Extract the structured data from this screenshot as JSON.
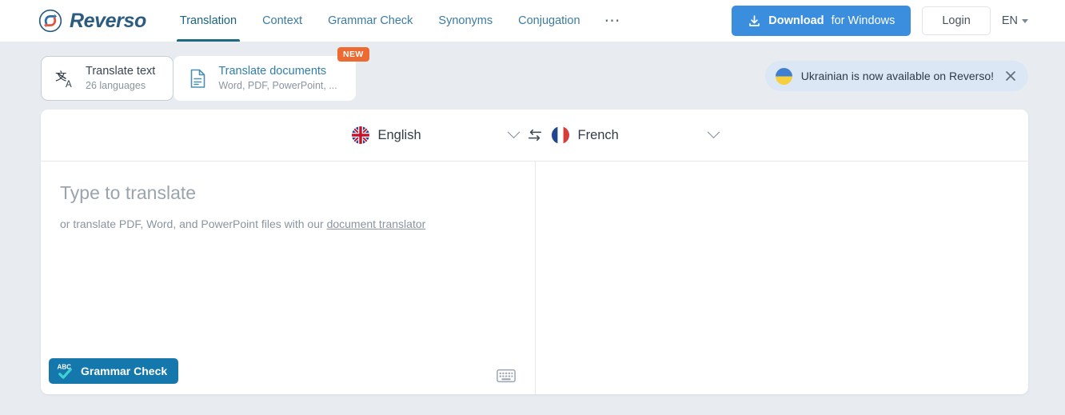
{
  "header": {
    "brand": "Reverso",
    "logo_icon": "reverso-cycle-arrows-logo",
    "nav": [
      {
        "label": "Translation",
        "active": true
      },
      {
        "label": "Context",
        "active": false
      },
      {
        "label": "Grammar Check",
        "active": false
      },
      {
        "label": "Synonyms",
        "active": false
      },
      {
        "label": "Conjugation",
        "active": false
      }
    ],
    "more_icon": "ellipsis-icon",
    "download_button": {
      "icon": "download-icon",
      "bold_label": "Download",
      "normal_label": "for Windows"
    },
    "login_label": "Login",
    "ui_language": "EN",
    "caret_icon": "caret-down-icon"
  },
  "modes": [
    {
      "icon": "translate-text-icon",
      "title": "Translate text",
      "subtitle": "26 languages",
      "active": true,
      "badge": null
    },
    {
      "icon": "document-icon",
      "title": "Translate documents",
      "subtitle": "Word, PDF, PowerPoint, ...",
      "active": false,
      "badge": "NEW"
    }
  ],
  "toast": {
    "flag_icon": "ukraine-flag-icon",
    "message": "Ukrainian is now available on Reverso!",
    "close_icon": "close-icon"
  },
  "translator": {
    "source_language": "English",
    "source_flag": "uk-flag-icon",
    "target_language": "French",
    "target_flag": "france-flag-icon",
    "swap_icon": "swap-arrows-icon",
    "chevron_icon": "chevron-down-icon",
    "input_placeholder": "Type to translate",
    "hint_prefix": "or translate PDF, Word, and PowerPoint files with our ",
    "hint_link": "document translator",
    "grammar_check": {
      "icon": "abc-check-icon",
      "label": "Grammar Check"
    },
    "keyboard_icon": "keyboard-icon",
    "output_text": ""
  },
  "colors": {
    "accent_blue": "#3b8ede",
    "brand_teal": "#1c6b80",
    "badge_orange": "#ed6a33",
    "page_bg": "#e8ecf1",
    "grammar_btn": "#1578ad"
  }
}
